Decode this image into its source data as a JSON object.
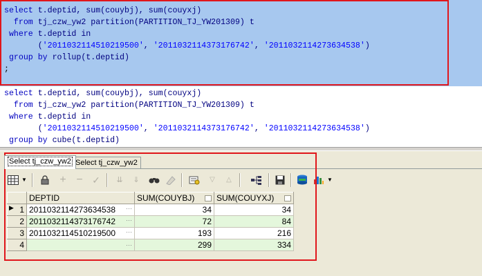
{
  "editor": {
    "query1": {
      "line1_kw": "select",
      "line1_rest": " t.deptid, sum(couybj), sum(couyxj)",
      "line2_kw": "  from",
      "line2_rest": " tj_czw_yw2 partition(PARTITION_TJ_YW201309) t",
      "line3_kw": " where",
      "line3_rest": " t.deptid in",
      "line4_pre": "       (",
      "line4_s1": "'2011032114510219500'",
      "line4_c1": ", ",
      "line4_s2": "'2011032114373176742'",
      "line4_c2": ", ",
      "line4_s3": "'2011032114273634538'",
      "line4_post": ")",
      "line5_kw": " group by",
      "line5_rest": " rollup(t.deptid)",
      "line6": ";"
    },
    "query2": {
      "line1_kw": "select",
      "line1_rest": " t.deptid, sum(couybj), sum(couyxj)",
      "line2_kw": "  from",
      "line2_rest": " tj_czw_yw2 partition(PARTITION_TJ_YW201309) t",
      "line3_kw": " where",
      "line3_rest": " t.deptid in",
      "line4_pre": "       (",
      "line4_s1": "'2011032114510219500'",
      "line4_c1": ", ",
      "line4_s2": "'2011032114373176742'",
      "line4_c2": ", ",
      "line4_s3": "'2011032114273634538'",
      "line4_post": ")",
      "line5_kw": " group by",
      "line5_rest": " cube(t.deptid)"
    }
  },
  "tabs": [
    {
      "label": "Select tj_czw_yw2",
      "active": true
    },
    {
      "label": "Select tj_czw_yw2",
      "active": false
    }
  ],
  "toolbar": {
    "icons": [
      "grid-icon",
      "lock-icon",
      "add-record-icon",
      "delete-record-icon",
      "post-icon",
      "fetch-next-icon",
      "fetch-last-icon",
      "find-icon",
      "clear-icon",
      "query-by-example-icon",
      "previous-icon",
      "next-icon",
      "tree-icon",
      "save-icon",
      "export-icon",
      "chart-icon"
    ]
  },
  "grid": {
    "columns": [
      "DEPTID",
      "SUM(COUYBJ)",
      "SUM(COUYXJ)"
    ],
    "rows": [
      {
        "num": "1",
        "deptid": "2011032114273634538",
        "couybj": "34",
        "couyxj": "34"
      },
      {
        "num": "2",
        "deptid": "2011032114373176742",
        "couybj": "72",
        "couyxj": "84"
      },
      {
        "num": "3",
        "deptid": "2011032114510219500",
        "couybj": "193",
        "couyxj": "216"
      },
      {
        "num": "4",
        "deptid": "",
        "couybj": "299",
        "couyxj": "334"
      }
    ],
    "ellipsis": "···"
  },
  "colors": {
    "selection": "#a7c8ef",
    "highlight_box": "#e0161b",
    "alt_row": "#e4f7dc"
  }
}
